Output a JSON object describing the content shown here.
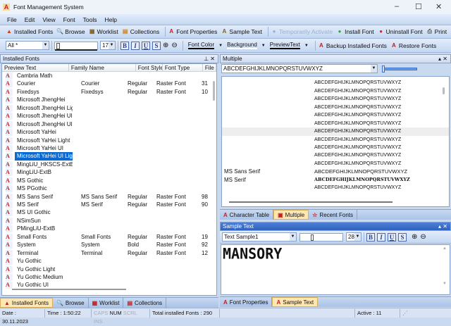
{
  "window": {
    "title": "Font Management System"
  },
  "menu": [
    "File",
    "Edit",
    "View",
    "Font",
    "Tools",
    "Help"
  ],
  "toolbar1": [
    {
      "label": "Installed Fonts",
      "icon": "installed-fonts-icon",
      "glyph": "▲",
      "color": "#d04010"
    },
    {
      "label": "Browse",
      "icon": "magnifier-icon",
      "glyph": "🔍",
      "color": "#3060a0"
    },
    {
      "label": "Worklist",
      "icon": "worklist-icon",
      "glyph": "▦",
      "color": "#806020"
    },
    {
      "label": "Collections",
      "icon": "collections-icon",
      "glyph": "▤",
      "color": "#d08020"
    },
    {
      "label": "Font Properties",
      "icon": "font-properties-icon",
      "glyph": "A",
      "color": "#c02020"
    },
    {
      "label": "Sample Text",
      "icon": "sample-text-icon",
      "glyph": "A",
      "color": "#806020"
    },
    {
      "label": "Temporarily Activate",
      "icon": "activate-icon",
      "glyph": "●",
      "color": "#8fb0e0",
      "disabled": true
    },
    {
      "label": "Install Font",
      "icon": "install-icon",
      "glyph": "●",
      "color": "#30b030"
    },
    {
      "label": "Uninstall Font",
      "icon": "uninstall-icon",
      "glyph": "●",
      "color": "#e02020"
    },
    {
      "label": "Print",
      "icon": "printer-icon",
      "glyph": "⎙",
      "color": "#555"
    }
  ],
  "toolbar2": {
    "filter": "All *",
    "size": "17",
    "format_buttons": [
      "B",
      "I",
      "U",
      "S"
    ],
    "font_color": "Font Color",
    "background": "Background",
    "preview_text": "PreviewText",
    "backup": "Backup Installed Fonts",
    "restore": "Restore Fonts"
  },
  "installed_panel": {
    "title": "Installed Fonts",
    "columns": [
      "Preview Text",
      "Family Name",
      "Font Style",
      "Font Type",
      "File Size"
    ],
    "rows": [
      [
        "Cambria Math",
        "",
        "",
        "",
        ""
      ],
      [
        "Courier",
        "Courier",
        "Regular",
        "Raster Font",
        "31"
      ],
      [
        "Fixedsys",
        "Fixedsys",
        "Regular",
        "Raster Font",
        "10"
      ],
      [
        "Microsoft JhengHei",
        "",
        "",
        "",
        ""
      ],
      [
        "Microsoft JhengHei Light",
        "",
        "",
        "",
        ""
      ],
      [
        "Microsoft JhengHei UI",
        "",
        "",
        "",
        ""
      ],
      [
        "Microsoft JhengHei UI Li...",
        "",
        "",
        "",
        ""
      ],
      [
        "Microsoft YaHei",
        "",
        "",
        "",
        ""
      ],
      [
        "Microsoft YaHei Light",
        "",
        "",
        "",
        ""
      ],
      [
        "Microsoft YaHei UI",
        "",
        "",
        "",
        ""
      ],
      [
        "Microsoft YaHei UI Light",
        "",
        "",
        "",
        ""
      ],
      [
        "MingLiU_HKSCS-ExtB",
        "",
        "",
        "",
        ""
      ],
      [
        "MingLiU-ExtB",
        "",
        "",
        "",
        ""
      ],
      [
        "MS Gothic",
        "",
        "",
        "",
        ""
      ],
      [
        "MS PGothic",
        "",
        "",
        "",
        ""
      ],
      [
        "MS Sans Serif",
        "MS Sans Serif",
        "Regular",
        "Raster Font",
        "98"
      ],
      [
        "MS Serif",
        "MS Serif",
        "Regular",
        "Raster Font",
        "90"
      ],
      [
        "MS UI Gothic",
        "",
        "",
        "",
        ""
      ],
      [
        "NSimSun",
        "",
        "",
        "",
        ""
      ],
      [
        "PMingLiU-ExtB",
        "",
        "",
        "",
        ""
      ],
      [
        "Small Fonts",
        "Small Fonts",
        "Regular",
        "Raster Font",
        "19"
      ],
      [
        "System",
        "System",
        "Bold",
        "Raster Font",
        "92"
      ],
      [
        "Terminal",
        "Terminal",
        "Regular",
        "Raster Font",
        "12"
      ],
      [
        "Yu Gothic",
        "",
        "",
        "",
        ""
      ],
      [
        "Yu Gothic Light",
        "",
        "",
        "",
        ""
      ],
      [
        "Yu Gothic Medium",
        "",
        "",
        "",
        ""
      ],
      [
        "Yu Gothic UI",
        "",
        "",
        "",
        ""
      ]
    ],
    "selected_index": 10,
    "tabs": [
      "Installed Fonts",
      "Browse",
      "Worklist",
      "Collections"
    ],
    "active_tab": 0
  },
  "multiple_panel": {
    "title": "Multiple",
    "preview_value": "ABCDEFGHIJKLMNOPQRSTUVWXYZ",
    "rows": [
      [
        "",
        ""
      ],
      [
        "",
        "ABCDEFGHIJKLMNOPQRSTUVWXYZ"
      ],
      [
        "",
        "ABCDEFGHIJKLMNOPQRSTUVWXYZ"
      ],
      [
        "",
        "ABCDEFGHIJKLMNOPQRSTUVWXYZ"
      ],
      [
        "",
        "ABCDEFGHIJKLMNOPQRSTUVWXYZ"
      ],
      [
        "",
        "ABCDEFGHIJKLMNOPQRSTUVWXYZ"
      ],
      [
        "",
        "ABCDEFGHIJKLMNOPQRSTUVWXYZ"
      ],
      [
        "",
        "ABCDEFGHIJKLMNOPQRSTUVWXYZ"
      ],
      [
        "",
        "ABCDEFGHIJKLMNOPQRSTUVWXYZ"
      ],
      [
        "",
        "ABCDEFGHIJKLMNOPQRSTUVWXYZ"
      ],
      [
        "",
        "ABCDEFGHIJKLMNOPQRSTUVWXYZ"
      ],
      [
        "",
        "ABCDEFGHIJKLMNOPQRSTUVWXYZ"
      ],
      [
        "MS Sans Serif",
        "ABCDEFGHIJKLMNOPQRSTUVWXYZ"
      ],
      [
        "MS Serif",
        "ABCDEFGHIJKLMNOPQRSTUVWXYZ"
      ],
      [
        "",
        "ABCDEFGHIJKLMNOPQRSTUVWXYZ"
      ]
    ],
    "highlighted_index": 7,
    "tabs": [
      "Character Table",
      "Multiple",
      "Recent Fonts"
    ],
    "active_tab": 1
  },
  "sample_panel": {
    "title": "Sample Text",
    "sample_select": "Text Sample1",
    "size": "28",
    "text": "MANSORY",
    "tabs": [
      "Font Properties",
      "Sample Text"
    ],
    "active_tab": 1
  },
  "status": {
    "date": "Date : 30.11.2023",
    "time": "Time : 1:50:22",
    "caps": "CAPS",
    "num": "NUM",
    "scrl": "SCRL",
    "ins": "INS",
    "total": "Total installed Fonts : 290",
    "active": "Active : 11"
  }
}
